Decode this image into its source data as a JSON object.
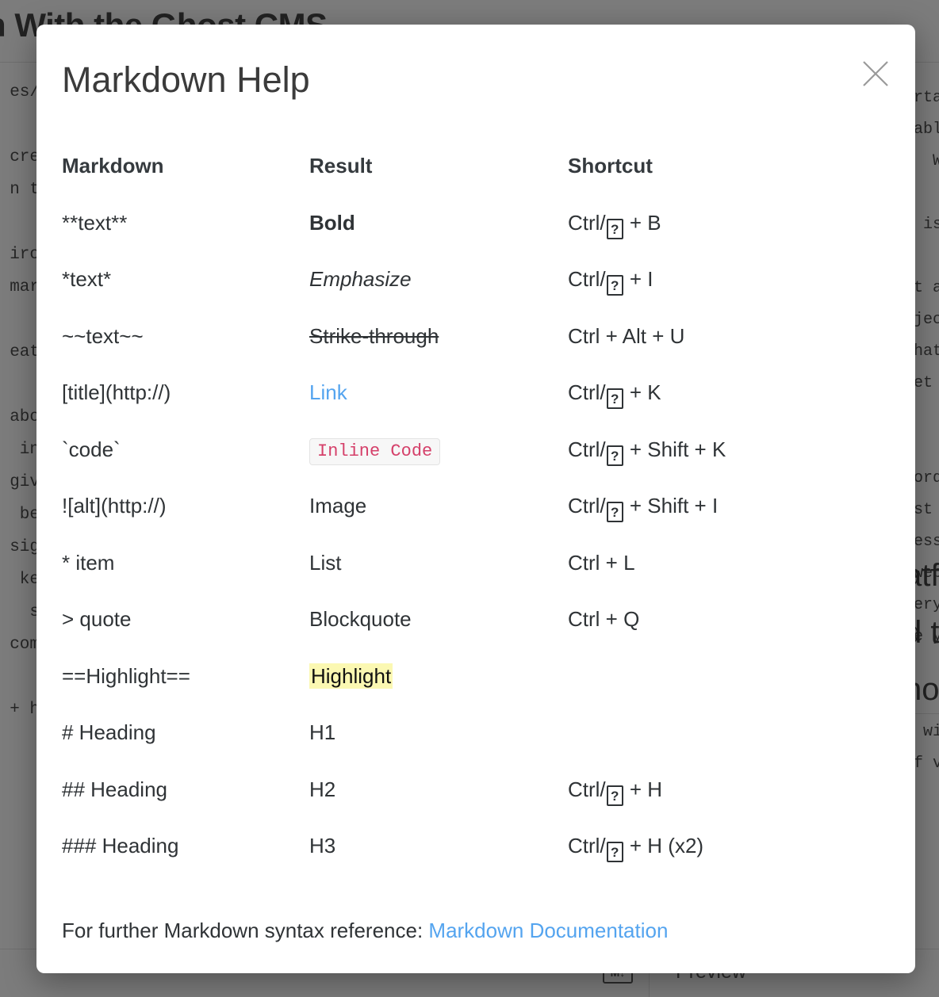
{
  "background": {
    "title": "h With the Ghost CMS",
    "left_lines": [
      "es/",
      "",
      "cre",
      "n t",
      "",
      "iro",
      "mar",
      "",
      "eat",
      "",
      "abo",
      " in",
      "giv",
      " be",
      "sig",
      "ke",
      "s",
      "com",
      "",
      "+ h"
    ],
    "right_lines": [
      "ertain",
      " able",
      "   Whic",
      "",
      "t is a",
      "",
      "nt a T",
      "ojects",
      "What i",
      "get a",
      "",
      "",
      "Wordpr",
      "ast fe",
      "ress.",
      " web c",
      "very n",
      "re you",
      ".",
      "",
      "s with",
      "of voc"
    ],
    "right_big_lines": [
      "atfo",
      "d th",
      "ho"
    ],
    "footer": {
      "markdown_badge": "M↓",
      "preview_label": "Preview"
    }
  },
  "modal": {
    "title": "Markdown Help",
    "close_label": "Close",
    "close_icon": "close-icon",
    "columns": {
      "markdown": "Markdown",
      "result": "Result",
      "shortcut": "Shortcut"
    },
    "rows": [
      {
        "markdown": "**text**",
        "result": "Bold",
        "result_style": "bold",
        "shortcut_prefix": "Ctrl/",
        "shortcut_tofu": "?",
        "shortcut_suffix": " + B"
      },
      {
        "markdown": "*text*",
        "result": "Emphasize",
        "result_style": "em",
        "shortcut_prefix": "Ctrl/",
        "shortcut_tofu": "?",
        "shortcut_suffix": " + I"
      },
      {
        "markdown": "~~text~~",
        "result": "Strike-through",
        "result_style": "strike",
        "shortcut_prefix": "Ctrl + Alt + U",
        "shortcut_tofu": "",
        "shortcut_suffix": ""
      },
      {
        "markdown": "[title](http://)",
        "result": "Link",
        "result_style": "link",
        "shortcut_prefix": "Ctrl/",
        "shortcut_tofu": "?",
        "shortcut_suffix": " + K"
      },
      {
        "markdown": "`code`",
        "result": "Inline Code",
        "result_style": "code",
        "shortcut_prefix": "Ctrl/",
        "shortcut_tofu": "?",
        "shortcut_suffix": " + Shift + K"
      },
      {
        "markdown": "![alt](http://)",
        "result": "Image",
        "result_style": "plain",
        "shortcut_prefix": "Ctrl/",
        "shortcut_tofu": "?",
        "shortcut_suffix": " + Shift + I"
      },
      {
        "markdown": "* item",
        "result": "List",
        "result_style": "plain",
        "shortcut_prefix": "Ctrl + L",
        "shortcut_tofu": "",
        "shortcut_suffix": ""
      },
      {
        "markdown": "> quote",
        "result": "Blockquote",
        "result_style": "plain",
        "shortcut_prefix": "Ctrl + Q",
        "shortcut_tofu": "",
        "shortcut_suffix": ""
      },
      {
        "markdown": "==Highlight==",
        "result": "Highlight",
        "result_style": "highlight",
        "shortcut_prefix": "",
        "shortcut_tofu": "",
        "shortcut_suffix": ""
      },
      {
        "markdown": "# Heading",
        "result": "H1",
        "result_style": "plain",
        "shortcut_prefix": "",
        "shortcut_tofu": "",
        "shortcut_suffix": ""
      },
      {
        "markdown": "## Heading",
        "result": "H2",
        "result_style": "plain",
        "shortcut_prefix": "Ctrl/",
        "shortcut_tofu": "?",
        "shortcut_suffix": " + H"
      },
      {
        "markdown": "### Heading",
        "result": "H3",
        "result_style": "plain",
        "shortcut_prefix": "Ctrl/",
        "shortcut_tofu": "?",
        "shortcut_suffix": " + H (x2)"
      }
    ],
    "footnote_text": "For further Markdown syntax reference: ",
    "footnote_link": "Markdown Documentation"
  },
  "colors": {
    "link": "#54a4ef",
    "code_text": "#d5406a",
    "code_bg": "#f7f7f7",
    "highlight_bg": "#fbf8b2",
    "text": "#2f3336",
    "overlay": "rgba(44,44,44,0.62)"
  }
}
